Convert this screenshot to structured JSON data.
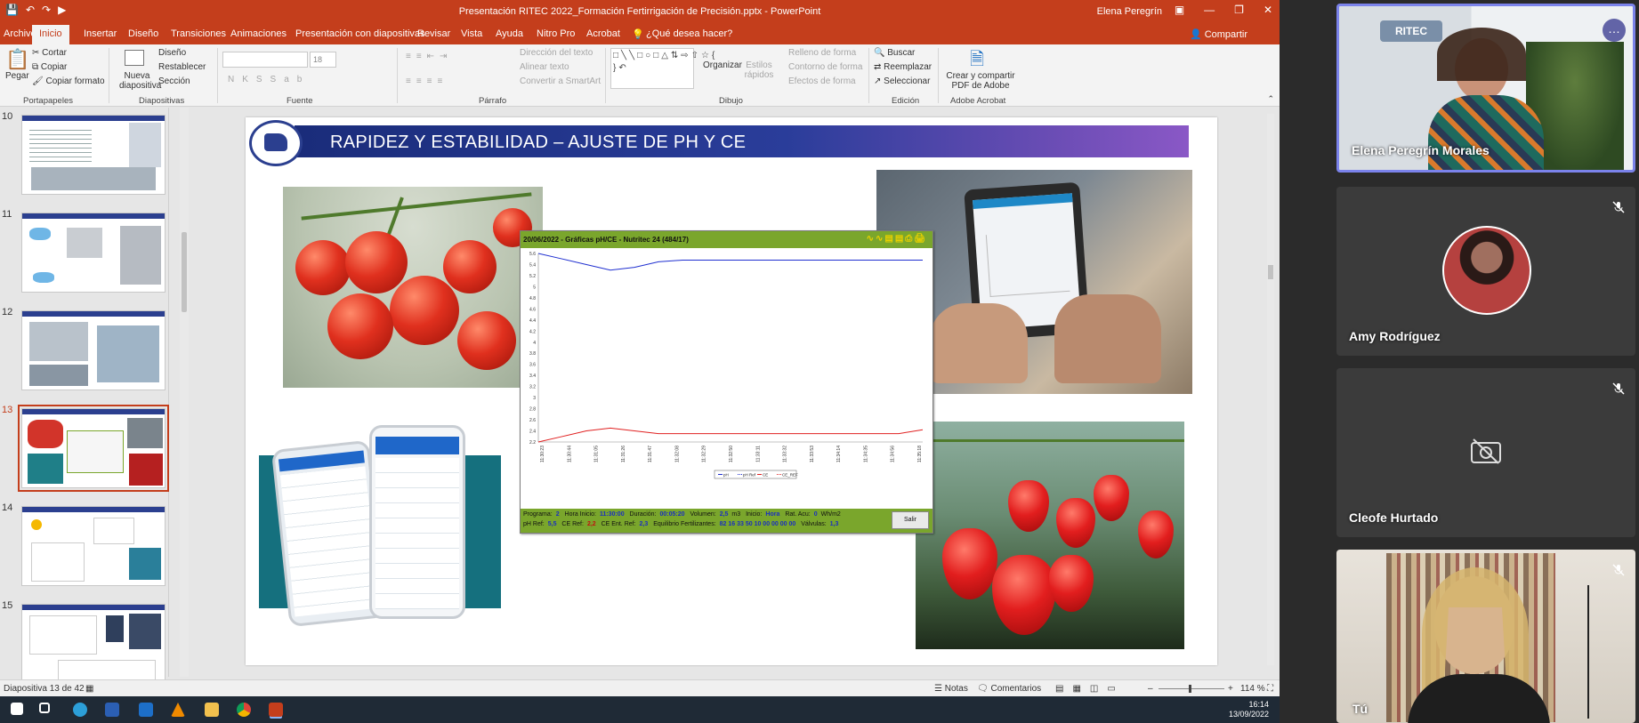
{
  "app": {
    "qat_icons": [
      "save-icon",
      "undo-icon",
      "redo-icon",
      "present-icon"
    ],
    "doc_title": "Presentación RITEC 2022_Formación Fertirrigación de Precisión.pptx  -  PowerPoint",
    "user": "Elena Peregrín",
    "tabs": [
      "Archivo",
      "Inicio",
      "Insertar",
      "Diseño",
      "Transiciones",
      "Animaciones",
      "Presentación con diapositivas",
      "Revisar",
      "Vista",
      "Ayuda",
      "Nitro Pro",
      "Acrobat",
      "¿Qué desea hacer?"
    ],
    "share": "Compartir"
  },
  "ribbon": {
    "paste": "Pegar",
    "cut": "Cortar",
    "copy": "Copiar",
    "format_painter": "Copiar formato",
    "new_slide": "Nueva diapositiva",
    "layout": "Diseño",
    "reset": "Restablecer",
    "section": "Sección",
    "font_size": "18",
    "text_direction": "Dirección del texto",
    "align_text": "Alinear texto",
    "smartart": "Convertir a SmartArt",
    "arrange": "Organizar",
    "quick_styles": "Estilos rápidos",
    "shape_fill": "Relleno de forma",
    "shape_outline": "Contorno de forma",
    "shape_effects": "Efectos de forma",
    "find": "Buscar",
    "replace": "Reemplazar",
    "select": "Seleccionar",
    "adobe": "Crear y compartir PDF de Adobe",
    "groups": [
      "Portapapeles",
      "Diapositivas",
      "Fuente",
      "Párrafo",
      "Dibujo",
      "Edición",
      "Adobe Acrobat"
    ]
  },
  "thumbnails": [
    "10",
    "11",
    "12",
    "13",
    "14",
    "15"
  ],
  "active_thumbnail": "13",
  "slide": {
    "title": "RAPIDEZ Y ESTABILIDAD – AJUSTE DE PH Y CE"
  },
  "nutritec": {
    "header": "20/06/2022 - Gráficas pH/CE - Nutritec 24 (484/17)",
    "row1": [
      "Programa:",
      "2",
      "Hora Inicio:",
      "11:30:00",
      "Duración:",
      "00:05:20",
      "Volumen:",
      "2,5",
      "m3",
      "Inicio:",
      "Hora",
      "Rat. Acu:",
      "0",
      "Wh/m2"
    ],
    "row2": [
      "pH Ref:",
      "5,5",
      "CE Ref:",
      "2,2",
      "CE Ent. Ref:",
      "2,3",
      "Equilibrio Fertilizantes:",
      "82 16 33 50 10 00 00 00 00",
      "Válvulas:",
      "1,3"
    ],
    "exit_button": "Salir",
    "legend": [
      "pH",
      "pH Ref",
      "CE",
      "CE_REF"
    ]
  },
  "chart_data": {
    "type": "line",
    "title": "",
    "y_ticks": [
      "5.6",
      "5.4",
      "5.2",
      "5",
      "4.8",
      "4.6",
      "4.4",
      "4.2",
      "4",
      "3.8",
      "3.6",
      "3.4",
      "3.2",
      "3",
      "2.8",
      "2.6",
      "2.4",
      "2.2"
    ],
    "x_ticks": [
      "11:30:23",
      "11:30:44",
      "11:31:05",
      "11:31:26",
      "11:31:47",
      "11:32:08",
      "11:32:29",
      "11:32:50",
      "11:33:11",
      "11:33:32",
      "11:33:53",
      "11:34:14",
      "11:34:35",
      "11:34:56",
      "11:35:18"
    ],
    "ylim": [
      2.2,
      5.6
    ],
    "series": [
      {
        "name": "pH",
        "color": "#1f2fd0",
        "values": [
          5.6,
          5.5,
          5.4,
          5.3,
          5.35,
          5.45,
          5.48,
          5.48,
          5.48,
          5.48,
          5.48,
          5.48,
          5.48,
          5.48,
          5.48,
          5.48,
          5.48
        ]
      },
      {
        "name": "CE",
        "color": "#e02020",
        "values": [
          2.2,
          2.3,
          2.4,
          2.45,
          2.4,
          2.35,
          2.35,
          2.35,
          2.35,
          2.35,
          2.35,
          2.35,
          2.35,
          2.35,
          2.35,
          2.35,
          2.42
        ]
      }
    ]
  },
  "statusbar": {
    "slide_info": "Diapositiva 13 de 42",
    "notes": "Notas",
    "comments": "Comentarios",
    "zoom": "114 %"
  },
  "taskbar": {
    "time": "16:14",
    "date": "13/09/2022"
  },
  "participants": [
    {
      "name": "Elena Peregrín Morales"
    },
    {
      "name": "Amy Rodríguez"
    },
    {
      "name": "Cleofe Hurtado"
    },
    {
      "name": "Tú"
    }
  ],
  "colors": {
    "accent": "#c43e1c",
    "teams": "#6264a7"
  }
}
